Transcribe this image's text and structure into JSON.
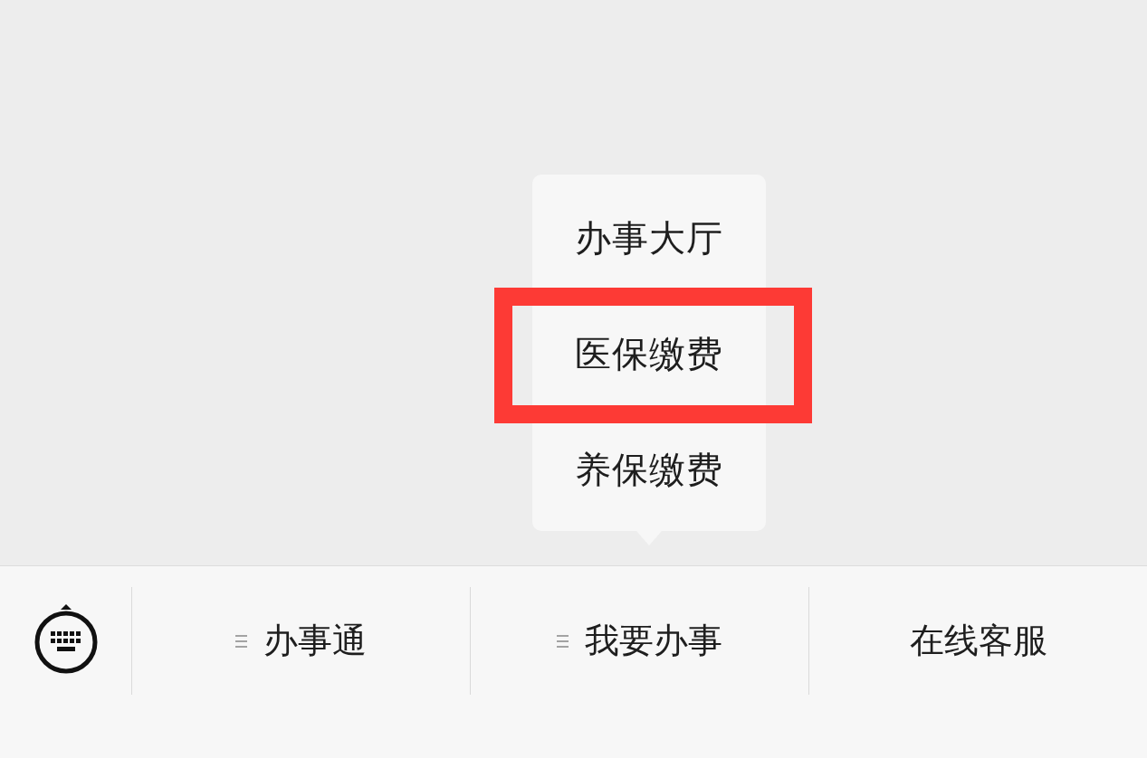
{
  "popup_menu": {
    "items": [
      {
        "label": "办事大厅",
        "highlighted": false
      },
      {
        "label": "医保缴费",
        "highlighted": true
      },
      {
        "label": "养保缴费",
        "highlighted": false
      }
    ]
  },
  "bottom_menu": {
    "items": [
      {
        "label": "办事通",
        "has_submenu": true
      },
      {
        "label": "我要办事",
        "has_submenu": true
      },
      {
        "label": "在线客服",
        "has_submenu": false
      }
    ]
  }
}
